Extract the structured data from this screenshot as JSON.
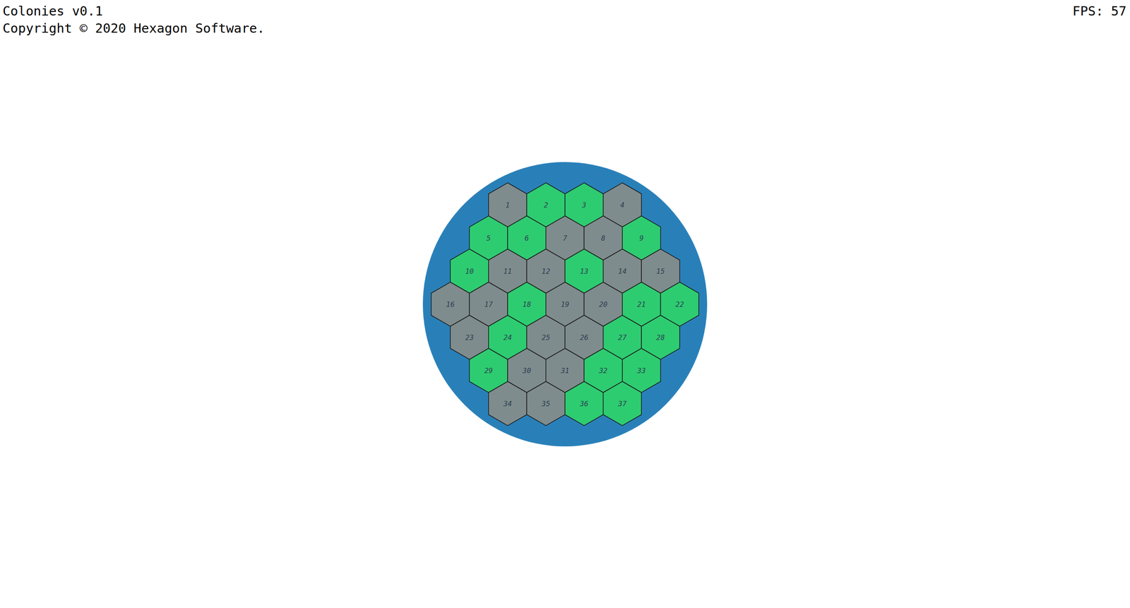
{
  "hud": {
    "title": "Colonies v0.1",
    "copyright": "Copyright © 2020 Hexagon Software.",
    "fps": "FPS: 57"
  },
  "board": {
    "rows": [
      [
        {
          "label": "1",
          "color": "#7f8c8d"
        },
        {
          "label": "2",
          "color": "#2ecc71"
        },
        {
          "label": "3",
          "color": "#2ecc71"
        },
        {
          "label": "4",
          "color": "#7f8c8d"
        }
      ],
      [
        {
          "label": "5",
          "color": "#2ecc71"
        },
        {
          "label": "6",
          "color": "#2ecc71"
        },
        {
          "label": "7",
          "color": "#7f8c8d"
        },
        {
          "label": "8",
          "color": "#7f8c8d"
        },
        {
          "label": "9",
          "color": "#2ecc71"
        }
      ],
      [
        {
          "label": "10",
          "color": "#2ecc71"
        },
        {
          "label": "11",
          "color": "#7f8c8d"
        },
        {
          "label": "12",
          "color": "#7f8c8d"
        },
        {
          "label": "13",
          "color": "#2ecc71"
        },
        {
          "label": "14",
          "color": "#7f8c8d"
        },
        {
          "label": "15",
          "color": "#7f8c8d"
        }
      ],
      [
        {
          "label": "16",
          "color": "#7f8c8d"
        },
        {
          "label": "17",
          "color": "#7f8c8d"
        },
        {
          "label": "18",
          "color": "#2ecc71"
        },
        {
          "label": "19",
          "color": "#7f8c8d"
        },
        {
          "label": "20",
          "color": "#7f8c8d"
        },
        {
          "label": "21",
          "color": "#2ecc71"
        },
        {
          "label": "22",
          "color": "#2ecc71"
        }
      ],
      [
        {
          "label": "23",
          "color": "#7f8c8d"
        },
        {
          "label": "24",
          "color": "#2ecc71"
        },
        {
          "label": "25",
          "color": "#7f8c8d"
        },
        {
          "label": "26",
          "color": "#7f8c8d"
        },
        {
          "label": "27",
          "color": "#2ecc71"
        },
        {
          "label": "28",
          "color": "#2ecc71"
        }
      ],
      [
        {
          "label": "29",
          "color": "#2ecc71"
        },
        {
          "label": "30",
          "color": "#7f8c8d"
        },
        {
          "label": "31",
          "color": "#7f8c8d"
        },
        {
          "label": "32",
          "color": "#2ecc71"
        },
        {
          "label": "33",
          "color": "#2ecc71"
        }
      ],
      [
        {
          "label": "34",
          "color": "#7f8c8d"
        },
        {
          "label": "35",
          "color": "#7f8c8d"
        },
        {
          "label": "36",
          "color": "#2ecc71"
        },
        {
          "label": "37",
          "color": "#2ecc71"
        }
      ]
    ]
  }
}
